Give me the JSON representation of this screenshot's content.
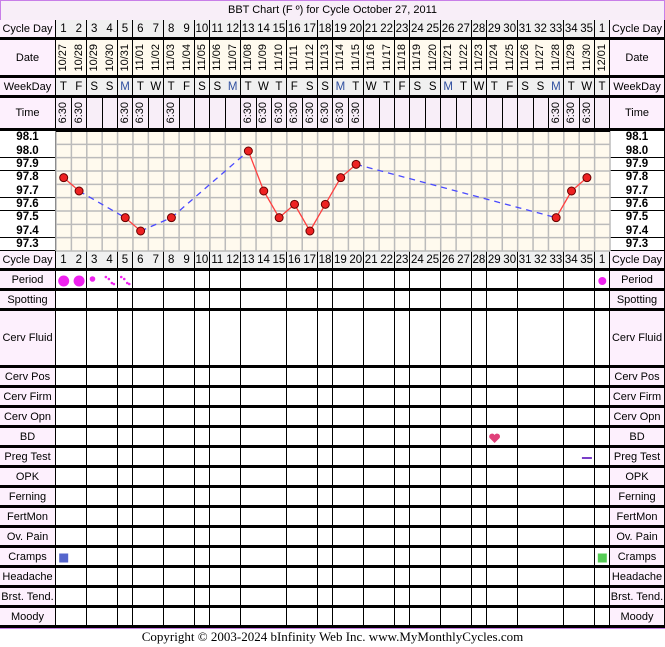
{
  "title": "BBT Chart (F º) for Cycle October 27, 2011",
  "copyright": "Copyright © 2003-2024 bInfinity Web Inc.     www.MyMonthlyCycles.com",
  "row_labels": {
    "cycle_day": "Cycle Day",
    "date": "Date",
    "weekday": "WeekDay",
    "time": "Time",
    "period": "Period",
    "spotting": "Spotting",
    "cerv_fluid": "Cerv Fluid",
    "cerv_pos": "Cerv Pos",
    "cerv_firm": "Cerv Firm",
    "cerv_opn": "Cerv Opn",
    "bd": "BD",
    "preg_test": "Preg Test",
    "opk": "OPK",
    "ferning": "Ferning",
    "fertmon": "FertMon",
    "ov_pain": "Ov. Pain",
    "cramps": "Cramps",
    "headache": "Headache",
    "brst_tend": "Brst. Tend.",
    "moody": "Moody"
  },
  "colors": {
    "line_solid": "#ff4040",
    "line_gap": "#4a4aff",
    "point": "#ee2222",
    "period": "#ee22ee",
    "heart": "#e0407a",
    "preg_test": "#7a3fc8",
    "cramps_day1": "#5566cc",
    "cramps_last": "#55cc55",
    "border": "#c87ee8"
  },
  "chart_data": {
    "type": "line",
    "title": "BBT Chart (F º) for Cycle October 27, 2011",
    "ylim": [
      97.3,
      98.1
    ],
    "y_ticks": [
      "98.1",
      "98.0",
      "97.9",
      "97.8",
      "97.7",
      "97.6",
      "97.5",
      "97.4",
      "97.3"
    ],
    "grid": true,
    "cycle_days": [
      "1",
      "2",
      "3",
      "4",
      "5",
      "6",
      "7",
      "8",
      "9",
      "10",
      "11",
      "12",
      "13",
      "14",
      "15",
      "16",
      "17",
      "18",
      "19",
      "20",
      "21",
      "22",
      "23",
      "24",
      "25",
      "26",
      "27",
      "28",
      "29",
      "30",
      "31",
      "32",
      "33",
      "34",
      "35",
      "1"
    ],
    "dates": [
      "10/27",
      "10/28",
      "10/29",
      "10/30",
      "10/31",
      "11/01",
      "11/02",
      "11/03",
      "11/04",
      "11/05",
      "11/06",
      "11/07",
      "11/08",
      "11/09",
      "11/10",
      "11/11",
      "11/12",
      "11/13",
      "11/14",
      "11/15",
      "11/16",
      "11/17",
      "11/18",
      "11/19",
      "11/20",
      "11/21",
      "11/22",
      "11/23",
      "11/24",
      "11/25",
      "11/26",
      "11/27",
      "11/28",
      "11/29",
      "11/30",
      "12/01"
    ],
    "weekdays": [
      "T",
      "F",
      "S",
      "S",
      "M",
      "T",
      "W",
      "T",
      "F",
      "S",
      "S",
      "M",
      "T",
      "W",
      "T",
      "F",
      "S",
      "S",
      "M",
      "T",
      "W",
      "T",
      "F",
      "S",
      "S",
      "M",
      "T",
      "W",
      "T",
      "F",
      "S",
      "S",
      "M",
      "T",
      "W",
      "T"
    ],
    "times": [
      "6:30",
      "6:30",
      "",
      "",
      "6:30",
      "6:30",
      "",
      "6:30",
      "",
      "",
      "",
      "",
      "6:30",
      "6:30",
      "6:30",
      "6:30",
      "6:30",
      "6:30",
      "6:30",
      "6:30",
      "",
      "",
      "",
      "",
      "",
      "",
      "",
      "",
      "",
      "",
      "",
      "",
      "6:30",
      "6:30",
      "6:30",
      ""
    ],
    "temps": [
      97.8,
      97.7,
      null,
      null,
      97.5,
      97.4,
      null,
      97.5,
      null,
      null,
      null,
      null,
      98.0,
      97.7,
      97.5,
      97.6,
      97.4,
      97.6,
      97.8,
      97.9,
      null,
      null,
      null,
      null,
      null,
      null,
      null,
      null,
      null,
      null,
      null,
      null,
      97.5,
      97.7,
      97.8,
      null
    ]
  },
  "observations": {
    "period": [
      "heavy",
      "heavy",
      "light",
      "spotting",
      "spotting",
      "",
      "",
      "",
      "",
      "",
      "",
      "",
      "",
      "",
      "",
      "",
      "",
      "",
      "",
      "",
      "",
      "",
      "",
      "",
      "",
      "",
      "",
      "",
      "",
      "",
      "",
      "",
      "",
      "",
      "",
      "medium"
    ],
    "bd_days": [
      29
    ],
    "preg_test": {
      "day_index": 35,
      "result": "negative"
    },
    "cramps": [
      {
        "day_index": 1,
        "icon": "square-blue"
      },
      {
        "day_index": 36,
        "icon": "square-green"
      }
    ]
  }
}
